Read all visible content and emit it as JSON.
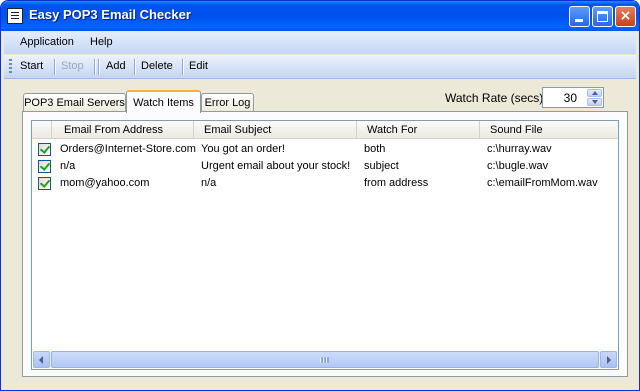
{
  "window": {
    "title": "Easy POP3 Email Checker",
    "accent_color": "#0054e3",
    "controls": {
      "minimize": "minimize-icon",
      "maximize": "maximize-icon",
      "close": "×"
    }
  },
  "menu": [
    "Application",
    "Help"
  ],
  "toolbar": {
    "start_label": "Start",
    "stop_label": "Stop",
    "add_label": "Add",
    "delete_label": "Delete",
    "edit_label": "Edit"
  },
  "tabs": [
    {
      "label": "POP3 Email Servers",
      "selected": false
    },
    {
      "label": "Watch Items",
      "selected": true
    },
    {
      "label": "Error Log",
      "selected": false
    }
  ],
  "watch_rate": {
    "label": "Watch Rate (secs)",
    "value": "30"
  },
  "table": {
    "columns": [
      "Email From Address",
      "Email Subject",
      "Watch For",
      "Sound File"
    ],
    "rows": [
      {
        "checked": true,
        "from": "Orders@Internet-Store.com",
        "subject": "You got an order!",
        "watch_for": "both",
        "sound": "c:\\hurray.wav"
      },
      {
        "checked": true,
        "from": "n/a",
        "subject": "Urgent email about your stock!",
        "watch_for": "subject",
        "sound": "c:\\bugle.wav"
      },
      {
        "checked": true,
        "from": "mom@yahoo.com",
        "subject": "n/a",
        "watch_for": "from address",
        "sound": "c:\\emailFromMom.wav"
      }
    ]
  }
}
